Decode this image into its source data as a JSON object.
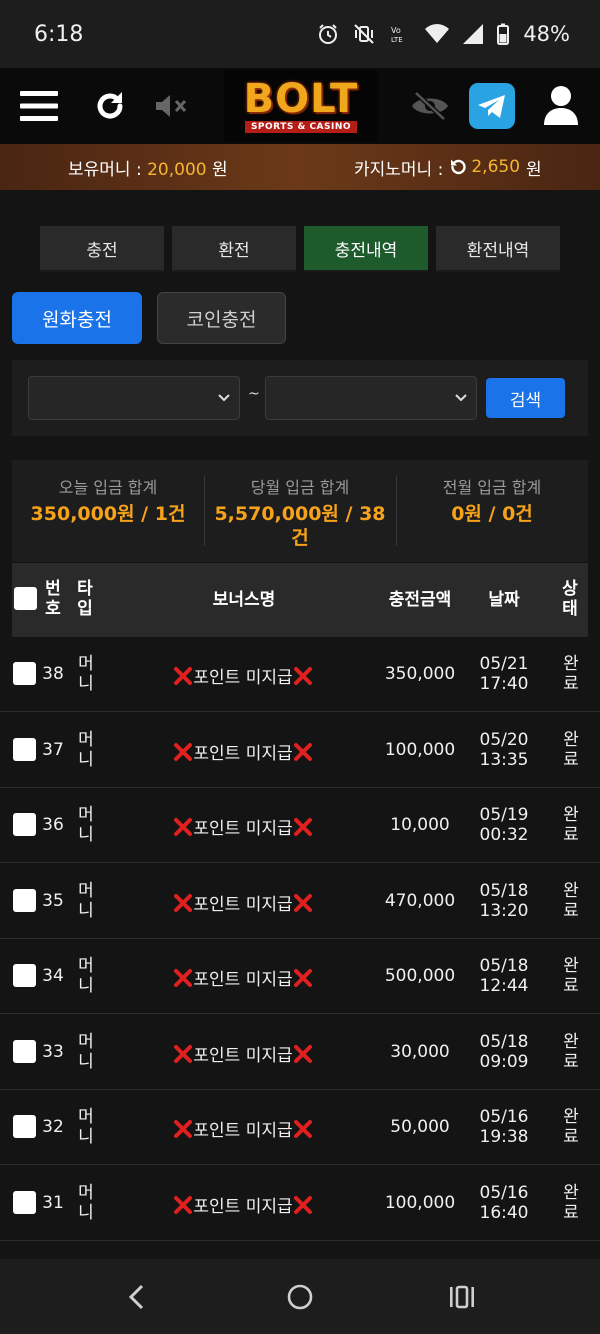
{
  "status": {
    "time": "6:18",
    "battery": "48%"
  },
  "header": {
    "logo_text": "BOLT",
    "logo_sub": "SPORTS & CASINO"
  },
  "money": {
    "holding_label": "보유머니 :",
    "holding_value": "20,000",
    "holding_unit": "원",
    "casino_label": "카지노머니 :",
    "casino_value": "2,650",
    "casino_unit": "원"
  },
  "tabs": [
    {
      "label": "충전"
    },
    {
      "label": "환전"
    },
    {
      "label": "충전내역"
    },
    {
      "label": "환전내역"
    }
  ],
  "subtabs": {
    "krw": "원화충전",
    "coin": "코인충전"
  },
  "search": {
    "separator": "~",
    "button": "검색"
  },
  "summary": [
    {
      "label": "오늘 입금 합계",
      "value_line1": "350,000원 / 1건",
      "value_line2": ""
    },
    {
      "label": "당월 입금 합계",
      "value_line1": "5,570,000원 / 38",
      "value_line2": "건"
    },
    {
      "label": "전월 입금 합계",
      "value_line1": "0원 / 0건",
      "value_line2": ""
    }
  ],
  "table": {
    "headers": {
      "no_1": "번",
      "no_2": "호",
      "type_1": "타",
      "type_2": "입",
      "bonus": "보너스명",
      "amount": "충전금액",
      "date": "날짜",
      "status_1": "상",
      "status_2": "태"
    },
    "rows": [
      {
        "no": "38",
        "type_1": "머",
        "type_2": "니",
        "bonus_text": "포인트 미지급",
        "amount": "350,000",
        "date": "05/21",
        "time": "17:40",
        "status_1": "완",
        "status_2": "료"
      },
      {
        "no": "37",
        "type_1": "머",
        "type_2": "니",
        "bonus_text": "포인트 미지급",
        "amount": "100,000",
        "date": "05/20",
        "time": "13:35",
        "status_1": "완",
        "status_2": "료"
      },
      {
        "no": "36",
        "type_1": "머",
        "type_2": "니",
        "bonus_text": "포인트 미지급",
        "amount": "10,000",
        "date": "05/19",
        "time": "00:32",
        "status_1": "완",
        "status_2": "료"
      },
      {
        "no": "35",
        "type_1": "머",
        "type_2": "니",
        "bonus_text": "포인트 미지급",
        "amount": "470,000",
        "date": "05/18",
        "time": "13:20",
        "status_1": "완",
        "status_2": "료"
      },
      {
        "no": "34",
        "type_1": "머",
        "type_2": "니",
        "bonus_text": "포인트 미지급",
        "amount": "500,000",
        "date": "05/18",
        "time": "12:44",
        "status_1": "완",
        "status_2": "료"
      },
      {
        "no": "33",
        "type_1": "머",
        "type_2": "니",
        "bonus_text": "포인트 미지급",
        "amount": "30,000",
        "date": "05/18",
        "time": "09:09",
        "status_1": "완",
        "status_2": "료"
      },
      {
        "no": "32",
        "type_1": "머",
        "type_2": "니",
        "bonus_text": "포인트 미지급",
        "amount": "50,000",
        "date": "05/16",
        "time": "19:38",
        "status_1": "완",
        "status_2": "료"
      },
      {
        "no": "31",
        "type_1": "머",
        "type_2": "니",
        "bonus_text": "포인트 미지급",
        "amount": "100,000",
        "date": "05/16",
        "time": "16:40",
        "status_1": "완",
        "status_2": "료"
      }
    ]
  },
  "icons": {
    "bonus_marker": "cross-mark-icon",
    "nav_back": "back-icon",
    "nav_home": "home-icon",
    "nav_recents": "recents-icon"
  },
  "colors": {
    "accent_blue": "#1a73e8",
    "active_tab": "#1d5a2c",
    "gold": "#f7b431",
    "mark_red": "#e0201e"
  }
}
